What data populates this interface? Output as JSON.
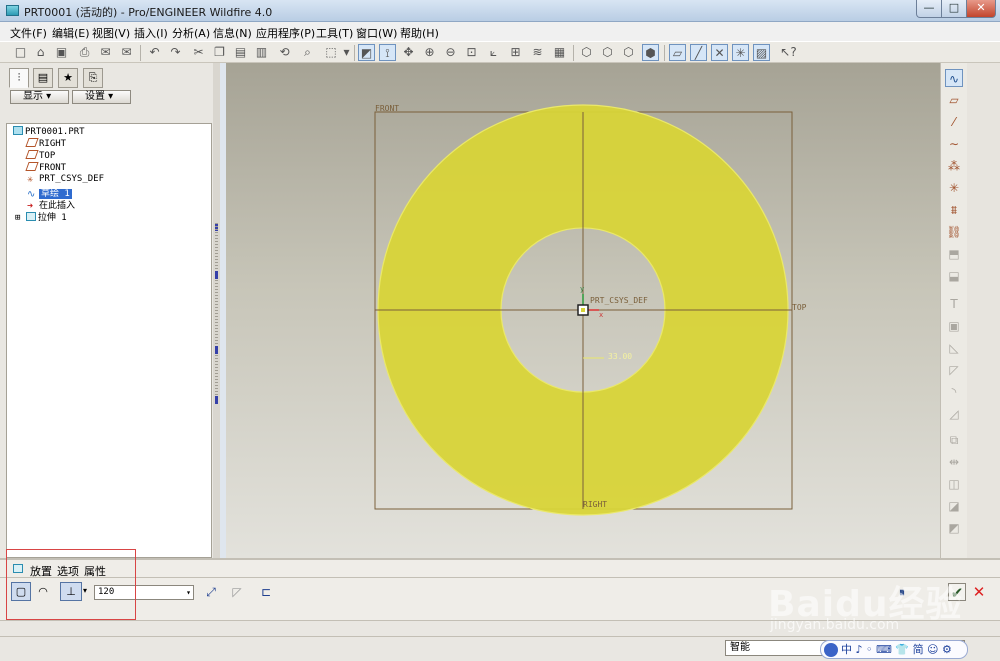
{
  "window": {
    "title": "PRT0001 (活动的) - Pro/ENGINEER Wildfire 4.0",
    "minimize": "—",
    "maximize": "□",
    "close": "✕"
  },
  "menu": [
    "文件(F)",
    "编辑(E)",
    "视图(V)",
    "插入(I)",
    "分析(A)",
    "信息(N)",
    "应用程序(P)",
    "工具(T)",
    "窗口(W)",
    "帮助(H)"
  ],
  "model_tree": {
    "display_button": "显示",
    "settings_button": "设置",
    "items": [
      {
        "label": "PRT0001.PRT",
        "icon": "part-icon"
      },
      {
        "label": "RIGHT",
        "icon": "datum-plane-icon"
      },
      {
        "label": "TOP",
        "icon": "datum-plane-icon"
      },
      {
        "label": "FRONT",
        "icon": "datum-plane-icon"
      },
      {
        "label": "PRT_CSYS_DEF",
        "icon": "csys-icon"
      },
      {
        "label": "草绘 1",
        "icon": "sketch-icon",
        "selected": true
      },
      {
        "label": "在此插入",
        "icon": "insert-arrow-icon"
      },
      {
        "label": "拉伸 1",
        "icon": "extrude-icon"
      }
    ]
  },
  "graphics": {
    "labels": {
      "front": "FRONT",
      "top": "TOP",
      "right": "RIGHT",
      "csys": "PRT_CSYS_DEF",
      "dimension": "33.00",
      "csys_x": "x",
      "csys_y": "y"
    },
    "fill_color": "#d8d438",
    "edge_color": "#eae86a",
    "datum_color": "#7a5f3a"
  },
  "dashboard": {
    "tabs": [
      "放置",
      "选项",
      "属性"
    ],
    "depth_value": "120",
    "confirm_icon": "✔",
    "cancel_icon": "✕"
  },
  "status": {
    "filter": "智能"
  },
  "ime": {
    "text": "中 ♪ ◦ ⌨ 👕 简 ☺ ⚙"
  },
  "watermark": {
    "logo": "Baidu经验",
    "url": "jingyan.baidu.com"
  }
}
